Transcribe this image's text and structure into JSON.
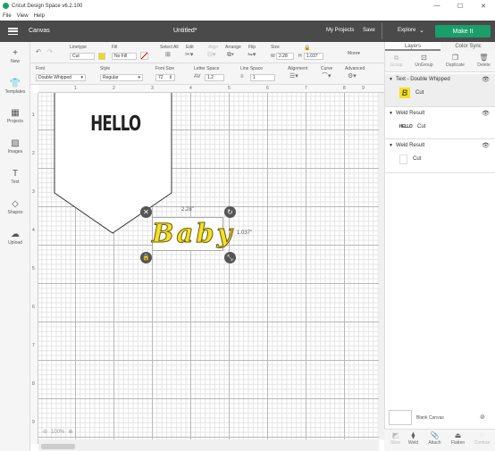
{
  "window": {
    "title": "Cricut Design Space v6.2.100",
    "min": "—",
    "max": "☐",
    "close": "✕"
  },
  "menu": [
    "File",
    "View",
    "Help"
  ],
  "header": {
    "canvas_label": "Canvas",
    "doc_title": "Untitled*",
    "my_projects": "My Projects",
    "save": "Save",
    "explore": "Explore",
    "make_it": "Make It"
  },
  "toolbar1": {
    "undo_icon": "undo-icon",
    "redo_icon": "redo-icon",
    "linetype_label": "Linetype",
    "linetype_value": "Cut",
    "fill_label": "Fill",
    "fill_value": "No Fill",
    "select_all": "Select All",
    "edit": "Edit",
    "align": "Align",
    "arrange": "Arrange",
    "flip": "Flip",
    "size_label": "Size",
    "w_label": "W",
    "w_value": "2.28",
    "h_label": "H",
    "h_value": "1.037",
    "more": "More",
    "linetype_color": "#f5d90a",
    "more_chev": "▾"
  },
  "toolbar2": {
    "font_label": "Font",
    "font_value": "Double Whipped",
    "style_label": "Style",
    "style_value": "Regular",
    "fontsize_label": "Font Size",
    "fontsize_value": "72",
    "letterspace_label": "Letter Space",
    "letterspace_value": "1.2",
    "linespace_label": "Line Space",
    "linespace_value": "1",
    "alignment_label": "Alignment",
    "curve_label": "Curve",
    "advanced_label": "Advanced"
  },
  "leftnav": [
    {
      "label": "New",
      "icon": "plus-icon",
      "glyph": "+"
    },
    {
      "label": "Templates",
      "icon": "shirt-icon",
      "glyph": "👕"
    },
    {
      "label": "Projects",
      "icon": "projects-icon",
      "glyph": "▦"
    },
    {
      "label": "Images",
      "icon": "images-icon",
      "glyph": "▨"
    },
    {
      "label": "Text",
      "icon": "text-icon",
      "glyph": "T"
    },
    {
      "label": "Shapes",
      "icon": "shapes-icon",
      "glyph": "◇"
    },
    {
      "label": "Upload",
      "icon": "upload-icon",
      "glyph": "☁"
    }
  ],
  "ruler_top": [
    "1",
    "2",
    "3",
    "4",
    "5",
    "6",
    "7",
    "8",
    "9",
    "10"
  ],
  "ruler_left": [
    "1",
    "2",
    "3",
    "4",
    "5",
    "6",
    "7",
    "8",
    "9"
  ],
  "canvas": {
    "banner_text": "HELLO",
    "baby_text": "Baby",
    "width_label": "2.28\"",
    "height_label": "1.037\"",
    "zoom": "100%"
  },
  "rightpanel": {
    "tab_layers": "Layers",
    "tab_colorsync": "Color Sync",
    "group": "Group",
    "ungroup": "UnGroup",
    "duplicate": "Duplicate",
    "delete": "Delete",
    "layers": [
      {
        "name": "Text - Double Whipped",
        "sub": "Cut",
        "thumb": "B"
      },
      {
        "name": "Weld Result",
        "sub": "Cut",
        "thumb": "HELLO"
      },
      {
        "name": "Weld Result",
        "sub": "Cut",
        "thumb": ""
      }
    ],
    "blank_canvas": "Blank Canvas",
    "bottom": [
      "Slice",
      "Weld",
      "Attach",
      "Flatten",
      "Contour"
    ]
  }
}
